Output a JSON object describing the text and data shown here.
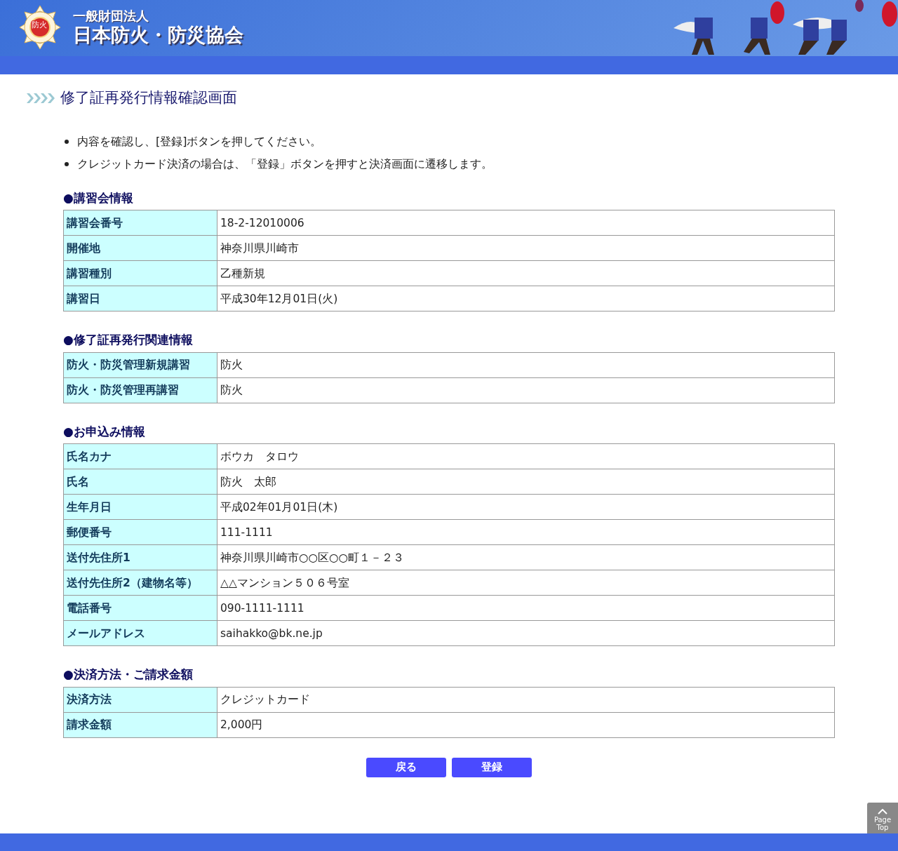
{
  "header": {
    "org_type": "一般財団法人",
    "org_name": "日本防火・防災協会",
    "logo_text": "防火"
  },
  "page_title": "修了証再発行情報確認画面",
  "instructions": [
    "内容を確認し、[登録]ボタンを押してください。",
    "クレジットカード決済の場合は、「登録」ボタンを押すと決済画面に遷移します。"
  ],
  "sections": [
    {
      "heading": "●講習会情報",
      "rows": [
        {
          "label": "講習会番号",
          "value": "18-2-12010006"
        },
        {
          "label": "開催地",
          "value": "神奈川県川崎市"
        },
        {
          "label": "講習種別",
          "value": "乙種新規"
        },
        {
          "label": "講習日",
          "value": "平成30年12月01日(火)"
        }
      ]
    },
    {
      "heading": "●修了証再発行関連情報",
      "rows": [
        {
          "label": "防火・防災管理新規講習",
          "value": "防火"
        },
        {
          "label": "防火・防災管理再講習",
          "value": "防火"
        }
      ]
    },
    {
      "heading": "●お申込み情報",
      "rows": [
        {
          "label": "氏名カナ",
          "value": "ボウカ　タロウ"
        },
        {
          "label": "氏名",
          "value": "防火　太郎"
        },
        {
          "label": "生年月日",
          "value": "平成02年01月01日(木)"
        },
        {
          "label": "郵便番号",
          "value": "111-1111"
        },
        {
          "label": "送付先住所1",
          "value": "神奈川県川崎市○○区○○町１－２３"
        },
        {
          "label": "送付先住所2（建物名等）",
          "value": "△△マンション５０６号室"
        },
        {
          "label": "電話番号",
          "value": "090-1111-1111"
        },
        {
          "label": "メールアドレス",
          "value": "saihakko@bk.ne.jp"
        }
      ]
    },
    {
      "heading": "●決済方法・ご請求金額",
      "rows": [
        {
          "label": "決済方法",
          "value": "クレジットカード"
        },
        {
          "label": "請求金額",
          "value": "2,000円"
        }
      ]
    }
  ],
  "buttons": [
    "戻る",
    "登録"
  ],
  "page_top": "Page Top"
}
